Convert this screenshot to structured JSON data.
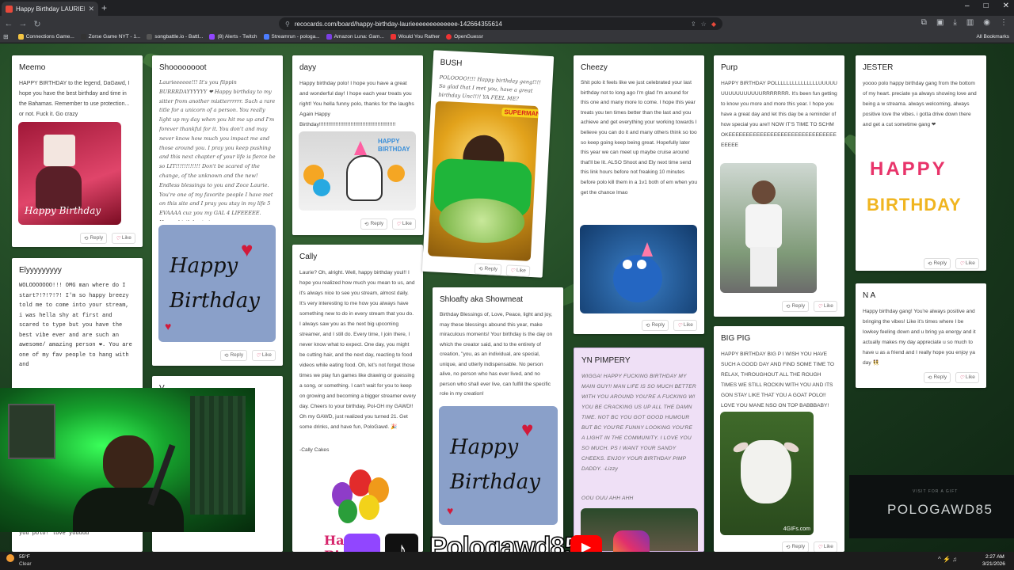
{
  "browser": {
    "tab_title": "Happy Birthday LAURIEEEEEEE",
    "url": "recocards.com/board/happy-birthday-laurieeeeeeeeeeeee-142664355614",
    "bookmarks": [
      "Connections Game...",
      "Zorse Game NYT - 1...",
      "songbattle.io - Battl...",
      "(8) Alerts - Twitch",
      "Streamrun - pologa...",
      "Amazon Luna: Gam...",
      "Would You Rather",
      "OpenGuessr"
    ],
    "all_bookmarks": "All Bookmarks",
    "colors": {
      "chrome_dark": "#202124",
      "chrome_mid": "#35363a"
    }
  },
  "cards": {
    "meemo": {
      "name": "Meemo",
      "message": "HAPPY BIRTHDAY to the legend, DaGawd, I hope you have the best birthday and time in the Bahamas. Remember to use protection... or not. Fuck it. Go crazy",
      "gif_caption": "Happy Birthday"
    },
    "elyy": {
      "name": "Elyyyyyyyyy",
      "message": "WOLOOOOOOO!!! OMG man where do I start?!?!?!?! I'm so happy breezy told me to come into your stream, i was hella shy at first and scared to type but you have the best vibe ever and are such an awesome/ amazing person ❤. You are one of my fav people to hang with and",
      "message_tail": "more memories and birthdays with you polo! love youuuu"
    },
    "shooo": {
      "name": "Shoooooooot",
      "message": "Laurieeeeee!!! It's you flippin BURRRDAYYYYYY ❤ Happy birthday to my sitter from another mistterrrrrr. Such a rare title for a unicorn of a person. You really light up my day when you hit me up and I'm forever thankful for it. You don't and may never know how much you impact me and those around you. I pray you keep pushing and this next chapter of your life is fierce be so LIT!!!!!!!!!!!! Don't be scared of the change, of the unknown and the new! Endless blessings to you and Zoce Laurie. You're one of my favorite people I have met on this site and I pray you stay in my life 5 EVAAAA cuz you my GAL 4 LIFEEEEE. Happy birthday twinnnnnnnnnnn",
      "card_art": "Happy Birthday"
    },
    "v": {
      "name": "V"
    },
    "dayy": {
      "name": "dayy",
      "message": "Happy birthday polo! I hope you have a great and wonderful day! I hope each year treats you right! You hella funny polo, thanks for the laughs Again Happy Birthday!!!!!!!!!!!!!!!!!!!!!!!!!!!!!!!!!!!!!!!!!!!!!!!!!!!",
      "gif_banner": "HAPPY BIRTHDAY"
    },
    "cally": {
      "name": "Cally",
      "message": "Laurie? Oh, alright. Well, happy birthday youl!! I hope you realized how much you mean to us, and it's always nice to see you stream, almost daily. It's very interesting to me how you always have something new to do in every stream that you do. I always saw you as the next big upcoming streamer, and I still do. Every time, I join there, I never know what to expect. One day, you might be cutting hair, and the next day, reacting to food videos while eating food. Oh, let's not forget those times we play fun games like drawing or guessing a song, or something. I can't wait for you to keep on growing and becoming a bigger streamer every day. Cheers to your birthday, Pol-OH my GAWD!! Oh my GAWD, just realized you turned 21. Get some drinks, and have fun, PoloGawd. 🎉",
      "signature": "-Cally Cakes",
      "art_text": "Happy Birthday"
    },
    "bush": {
      "name": "BUSH",
      "message": "POLOOOO!!!! Happy birthday gang!!!! So glad that I met you, have a great birthday Unc!!!! YA FEEL ME?",
      "gif_logo": "SUPERMAN"
    },
    "shloafty": {
      "name": "Shloafty aka Showmeat",
      "message": "Birthday Blessings of, Love, Peace, light and joy, may these blessings abound this year, make miraculous moments! Your birthday is the day on which the creator said, and to the entirety of creation, \"you, as an individual, are special, unique, and utterly indispensable. No person alive, no person who has ever lived, and no person who shall ever live, can fulfill the specific role in my creation!",
      "card_art": "Happy Birthday"
    },
    "cheezy": {
      "name": "Cheezy",
      "message": "Shit polo it feels like we just celebrated your last birthday not to long ago I'm glad I'm around for this one and many more to come. I hope this year treats you ten times better than the last and you achieve and get everything your working towards I believe you can do it and many others think so too so keep going keep being great. Hopefully later this year we can meet up maybe cruise around that'll be lit. ALSO Shoot and Ely next time send this link hours before not freaking 10 minutes before polo kill them in a 1v1 both of em when you get the chance lmao"
    },
    "yn": {
      "name": "YN PIMPERY",
      "message": "WIGGA! HAPPY FUCKING BIRTHDAY MY MAIN GUY!! MAN LIFE IS SO MUCH BETTER WITH YOU AROUND YOU'RE A FUCKING W! YOU BE CRACKING US UP ALL THE DAMN TIME. NOT BC YOU GOT GOOD HUMOUR BUT BC YOU'RE FUNNY LOOKING YOU'RE A LIGHT IN THE COMMUNITY. I LOVE YOU SO MUCH. PS I WANT YOUR SANDY CHEEKS. ENJOY YOUR BIRTHDAY PIMP DADDY. -Lizzy",
      "tail": "OOU OUU AHH AHH"
    },
    "purp": {
      "name": "Purp",
      "message": "HAPPY BIRTHDAY POLLLLLLLLLLLLLLLUUUUUUUUUUUUUUUURRRRRRR. It's been fun getting to know you more and more this year. I hope you have a great day and let this day be a reminder of how special you are!! NOW IT'S TIME TO SCHMOKEEEEEEEEEEEEEEEEEEEEEEEEEEEEEEEEEEEE"
    },
    "bigpig": {
      "name": "BIG PIG",
      "message": "HAPPY BIRTHDAY BIG P I WISH YOU HAVE SUCH A GOOD DAY AND FIND SOME TIME TO RELAX, THROUGHOUT ALL THE ROUGH TIMES WE STILL ROCKIN WITH YOU AND ITS GON STAY LIKE THAT YOU A GOAT POLO!! LOVE YOU MANE NSO ON TOP BABBBABY!",
      "gif_watermark": "4GIFs.com"
    },
    "jester": {
      "name": "JESTER",
      "message": "yoooo polo happy birthday gang from the bottom of my heart. preciate ya always showing love and being a w streama. always welcoming, always positive love the vibes. i gotta drive down there and get a cut sometime gang ❤",
      "card_line1": "HAPPY",
      "card_line2": "BIRTHDAY"
    },
    "na": {
      "name": "N A",
      "message": "Happy birthday gang! You're always positive and bringing the vibes! Like it's times where I be lowkey feeling down and u bring ya energy and it actually makes my day appreciate u so much to have u as a friend and I really hope you enjoy ya day 👯"
    }
  },
  "actions": {
    "reply": "Reply",
    "like": "Like"
  },
  "stream": {
    "brand_small": "VISIT FOR A GIFT",
    "brand": "POLOGAWD85",
    "social_handle": "Pologawd85"
  },
  "taskbar": {
    "temp": "55°F",
    "weather": "Clear",
    "time": "2:27 AM",
    "date": "3/21/2026"
  }
}
